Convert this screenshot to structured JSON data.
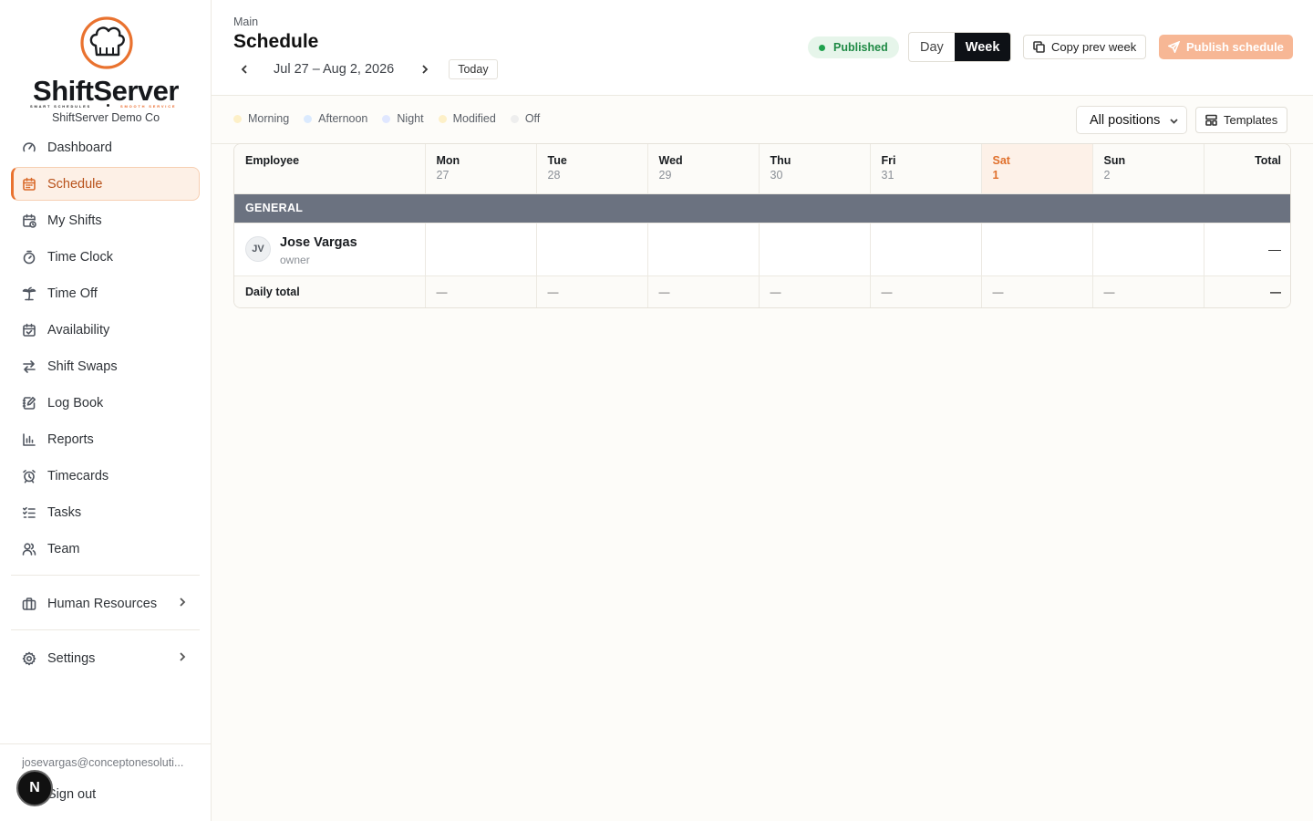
{
  "brand": {
    "name": "ShiftServer",
    "tagline_left": "SMART SCHEDULES",
    "tagline_right": "SMOOTH SERVICE",
    "company": "ShiftServer Demo Co",
    "accent": "#e9722f"
  },
  "sidebar": {
    "items": [
      {
        "label": "Dashboard",
        "icon": "gauge-icon"
      },
      {
        "label": "Schedule",
        "icon": "calendar-icon",
        "active": true
      },
      {
        "label": "My Shifts",
        "icon": "calendar-clock-icon"
      },
      {
        "label": "Time Clock",
        "icon": "stopwatch-icon"
      },
      {
        "label": "Time Off",
        "icon": "palm-tree-icon"
      },
      {
        "label": "Availability",
        "icon": "calendar-check-icon"
      },
      {
        "label": "Shift Swaps",
        "icon": "swap-icon"
      },
      {
        "label": "Log Book",
        "icon": "notebook-pen-icon"
      },
      {
        "label": "Reports",
        "icon": "bar-chart-icon"
      },
      {
        "label": "Timecards",
        "icon": "alarm-clock-icon"
      },
      {
        "label": "Tasks",
        "icon": "checklist-icon"
      },
      {
        "label": "Team",
        "icon": "users-icon"
      }
    ],
    "human_resources": "Human Resources",
    "settings": "Settings",
    "user_email": "josevargas@conceptonesoluti...",
    "sign_out": "Sign out",
    "badge_letter": "N"
  },
  "header": {
    "breadcrumb": "Main",
    "title": "Schedule",
    "date_range": "Jul 27 – Aug 2, 2026",
    "today": "Today",
    "status": "Published",
    "view_day": "Day",
    "view_week": "Week",
    "copy_prev_week": "Copy prev week",
    "publish": "Publish schedule"
  },
  "toolbar": {
    "legend": [
      {
        "label": "Morning",
        "color": "#fdf0c8"
      },
      {
        "label": "Afternoon",
        "color": "#dbeafe"
      },
      {
        "label": "Night",
        "color": "#e0e7ff"
      },
      {
        "label": "Modified",
        "color": "#fdf0c8"
      },
      {
        "label": "Off",
        "color": "#eeeeee"
      }
    ],
    "positions": "All positions",
    "templates": "Templates"
  },
  "grid": {
    "columns": [
      {
        "day": "Employee",
        "date": ""
      },
      {
        "day": "Mon",
        "date": "27"
      },
      {
        "day": "Tue",
        "date": "28"
      },
      {
        "day": "Wed",
        "date": "29"
      },
      {
        "day": "Thu",
        "date": "30"
      },
      {
        "day": "Fri",
        "date": "31"
      },
      {
        "day": "Sat",
        "date": "1"
      },
      {
        "day": "Sun",
        "date": "2"
      },
      {
        "day": "Total",
        "date": ""
      }
    ],
    "group": "GENERAL",
    "employee": {
      "initials": "JV",
      "name": "Jose Vargas",
      "role": "owner",
      "total": "—"
    },
    "daily_total_label": "Daily total",
    "daily_totals": [
      "—",
      "—",
      "—",
      "—",
      "—",
      "—",
      "—"
    ],
    "daily_grand_total": "—"
  }
}
